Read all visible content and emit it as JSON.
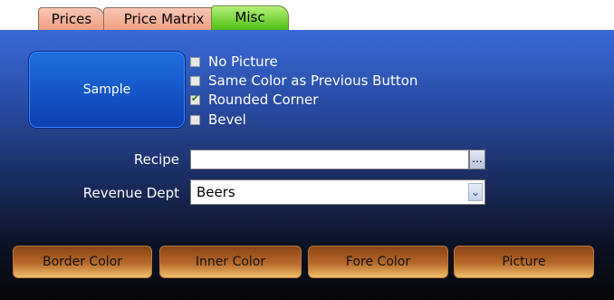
{
  "tabs": [
    {
      "label": "Prices",
      "active": false
    },
    {
      "label": "Price Matrix",
      "active": false
    },
    {
      "label": "Misc",
      "active": true
    }
  ],
  "sample_button": {
    "label": "Sample"
  },
  "checkboxes": [
    {
      "label": "No Picture",
      "checked": false
    },
    {
      "label": "Same Color as Previous Button",
      "checked": false
    },
    {
      "label": "Rounded Corner",
      "checked": true
    },
    {
      "label": "Bevel",
      "checked": false
    }
  ],
  "recipe": {
    "label": "Recipe",
    "value": "",
    "browse_label": "..."
  },
  "revenue_dept": {
    "label": "Revenue Dept",
    "value": "Beers"
  },
  "bottom_buttons": [
    {
      "label": "Border Color"
    },
    {
      "label": "Inner Color"
    },
    {
      "label": "Fore Color"
    },
    {
      "label": "Picture"
    }
  ],
  "colors": {
    "panel_top": "#3a6ad6",
    "panel_bottom": "#050709",
    "tab_active": "#4fbf12",
    "tab_inactive": "#ef9f83",
    "sample_blue": "#0c3fb0",
    "bottom_button": "#b86a2b"
  }
}
